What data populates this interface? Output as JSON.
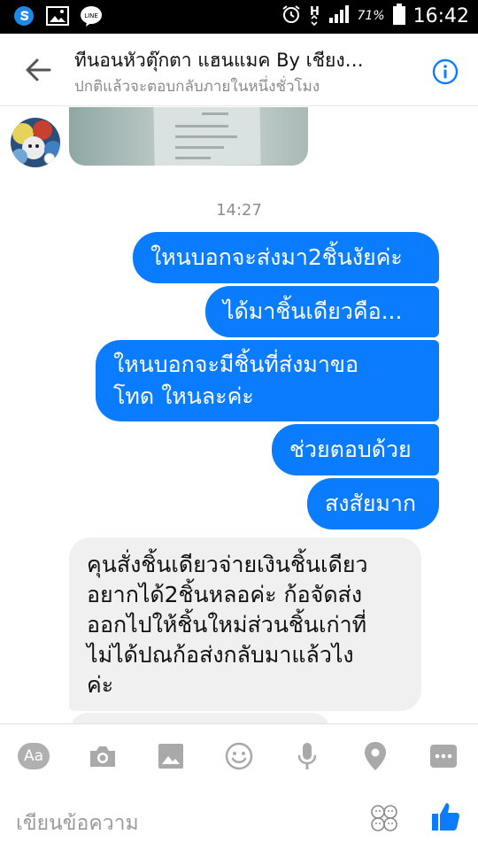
{
  "status_bar": {
    "battery_percent": "71%",
    "time": "16:42",
    "icons": [
      "s-app-icon",
      "gallery-icon",
      "line-app-icon",
      "alarm-icon",
      "hspa-signal-icon",
      "signal-bars-icon",
      "battery-icon"
    ]
  },
  "header": {
    "title": "ทีนอนหัวตุ๊กตา แฮนแมค By เชียง…",
    "subtitle": "ปกติแล้วจะตอบกลับภายในหนึ่งชั่วโมง",
    "icons": [
      "back-arrow-icon",
      "info-icon"
    ]
  },
  "chat": {
    "timestamp": "14:27",
    "outgoing": [
      "ใหนบอกจะส่งมา2ชิ้นงัยค่ะ",
      "ได้มาชิ้นเดียวคือ...",
      "ใหนบอกจะมีชิ้นที่ส่งมาขอ\nโทด ใหนละค่ะ",
      "ช่วยตอบด้วย",
      "สงสัยมาก"
    ],
    "incoming": [
      "คุนสั่งชิ้นเดียวจ่ายเงินชิ้นเดียว\nอยากได้2ชิ้นหลอค่ะ ก้อจัดส่ง\nออกไปให้ชิ้นใหม่ส่วนชิ้นเก่าที่\nไม่ได้ปณก้อส่งกลับมาแล้วไง\nค่ะ"
    ]
  },
  "composer": {
    "aa_label": "Aa",
    "placeholder": "เขียนข้อความ",
    "icons": [
      "aa-icon",
      "camera-icon",
      "image-icon",
      "smiley-icon",
      "microphone-icon",
      "location-pin-icon",
      "more-icon",
      "sticker-icon",
      "thumbs-up-icon"
    ]
  },
  "colors": {
    "outgoing_bubble": "#0a7cff",
    "incoming_bubble": "#f0f0f0",
    "accent": "#0a7cff"
  }
}
